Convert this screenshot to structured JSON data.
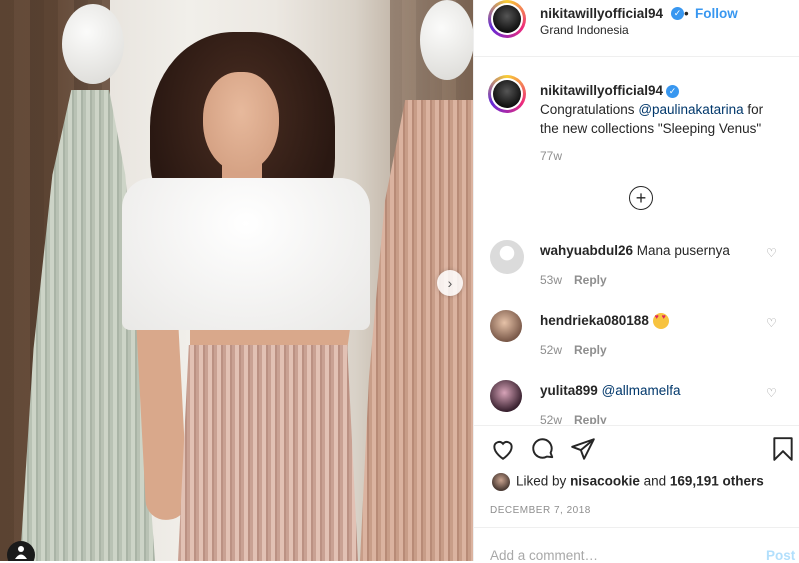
{
  "post": {
    "username": "nikitawillyofficial94",
    "follow_label": "Follow",
    "separator": "•",
    "location": "Grand Indonesia"
  },
  "caption": {
    "username": "nikitawillyofficial94",
    "text_1": "Congratulations ",
    "mention": "@paulinakatarina",
    "text_2": " for the new collections \"Sleeping Venus\"",
    "time": "77w"
  },
  "more_comments_icon": "plus-circle-icon",
  "comments": [
    {
      "username": "wahyuabdul26",
      "text": "Mana pusernya",
      "time": "53w",
      "reply": "Reply"
    },
    {
      "username": "hendrieka080188",
      "text": "",
      "emoji": "heart-eyes-emoji",
      "time": "52w",
      "reply": "Reply"
    },
    {
      "username": "yulita899",
      "text": "@allmamelfa",
      "time": "52w",
      "reply": "Reply"
    }
  ],
  "likes": {
    "prefix": "Liked by",
    "user": "nisacookie",
    "and": "and",
    "count": "169,191 others"
  },
  "date": "DECEMBER 7, 2018",
  "add_comment": {
    "placeholder": "Add a comment…",
    "post_label": "Post"
  },
  "colors": {
    "link": "#3897f0",
    "mention": "#00376b",
    "muted": "#8e8e8e",
    "post_disabled": "#b2dffc"
  }
}
